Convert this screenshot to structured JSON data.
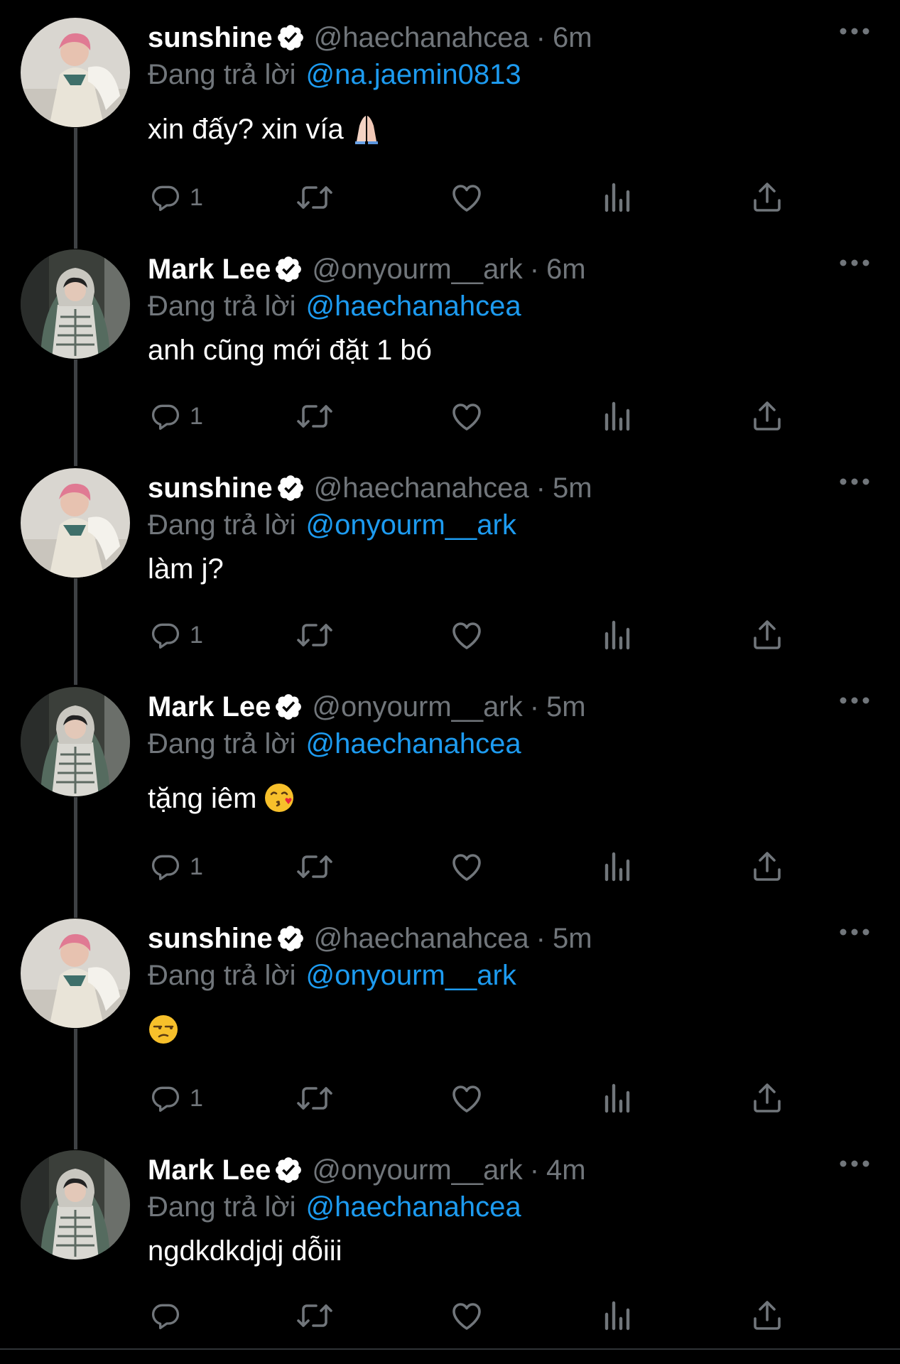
{
  "reply_prefix": "Đang trả lời",
  "colors": {
    "background": "#000000",
    "text": "#ffffff",
    "secondary": "#71767b",
    "accent": "#1d9bf0",
    "verified": "#ffffff"
  },
  "icons": {
    "reply": "reply-icon",
    "retweet": "retweet-icon",
    "like": "heart-icon",
    "views": "views-icon",
    "share": "share-icon",
    "more": "more-icon",
    "verified": "verified-badge-icon"
  },
  "tweets": [
    {
      "name": "sunshine",
      "handle": "@haechanahcea",
      "time": "6m",
      "replying_to": "@na.jaemin0813",
      "text": "xin đấy? xin vía",
      "emoji": "folded-hands-emoji",
      "reply_count": "1",
      "avatar": "sunshine-avatar"
    },
    {
      "name": "Mark Lee",
      "handle": "@onyourm__ark",
      "time": "6m",
      "replying_to": "@haechanahcea",
      "text": "anh cũng mới đặt 1 bó",
      "emoji": "",
      "reply_count": "1",
      "avatar": "mark-avatar"
    },
    {
      "name": "sunshine",
      "handle": "@haechanahcea",
      "time": "5m",
      "replying_to": "@onyourm__ark",
      "text": "làm j?",
      "emoji": "",
      "reply_count": "1",
      "avatar": "sunshine-avatar"
    },
    {
      "name": "Mark Lee",
      "handle": "@onyourm__ark",
      "time": "5m",
      "replying_to": "@haechanahcea",
      "text": "tặng iêm",
      "emoji": "kissing-face-emoji",
      "reply_count": "1",
      "avatar": "mark-avatar"
    },
    {
      "name": "sunshine",
      "handle": "@haechanahcea",
      "time": "5m",
      "replying_to": "@onyourm__ark",
      "text": "",
      "emoji": "unamused-face-emoji",
      "reply_count": "1",
      "avatar": "sunshine-avatar"
    },
    {
      "name": "Mark Lee",
      "handle": "@onyourm__ark",
      "time": "4m",
      "replying_to": "@haechanahcea",
      "text": "ngdkdkdjdj dỗiii",
      "emoji": "",
      "reply_count": "",
      "avatar": "mark-avatar"
    }
  ]
}
